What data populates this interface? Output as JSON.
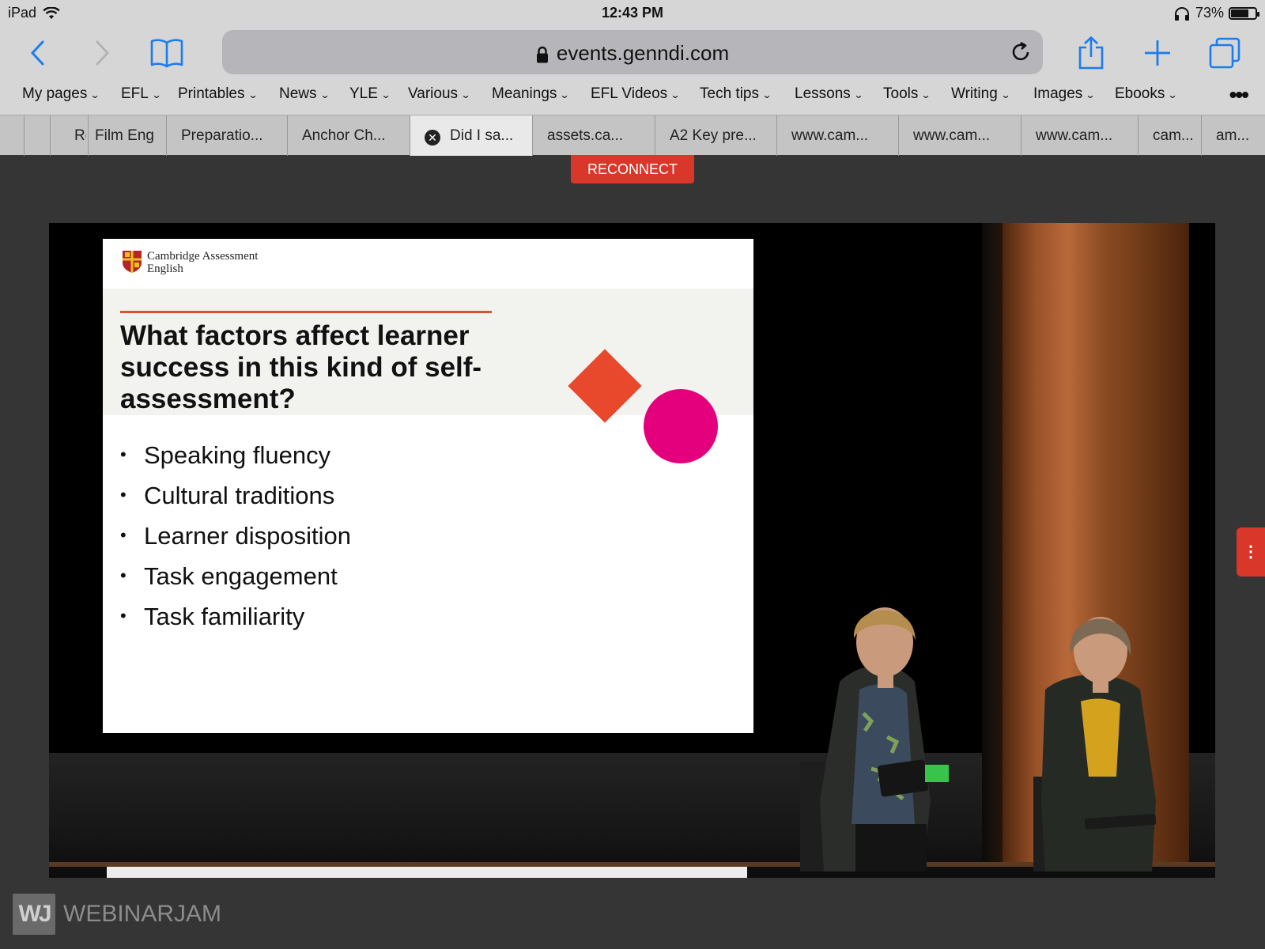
{
  "status_bar": {
    "device": "iPad",
    "time": "12:43 PM",
    "battery": "73%",
    "battery_level": 0.73
  },
  "browser": {
    "url": "events.genndi.com",
    "bookmarks": [
      "My pages",
      "EFL",
      "Printables",
      "News",
      "YLE",
      "Various",
      "Meanings",
      "EFL Videos",
      "Tech tips",
      "Lessons",
      "Tools",
      "Writing",
      "Images",
      "Ebooks"
    ],
    "tabs": [
      "Re",
      "Film Eng",
      "Preparatio...",
      "Anchor Ch...",
      "Did I sa...",
      "assets.ca...",
      "A2 Key pre...",
      "www.cam...",
      "www.cam...",
      "www.cam...",
      "cam...",
      "am..."
    ],
    "active_tab": "Did I sa..."
  },
  "page": {
    "reconnect_label": "RECONNECT",
    "footer_brand": "WEBINARJAM",
    "footer_brand_mark": "WJ"
  },
  "slide": {
    "logo_line1": "Cambridge Assessment",
    "logo_line2": "English",
    "title": "What factors affect learner success in this kind of self-assessment?",
    "bullets": [
      "Speaking fluency",
      "Cultural traditions",
      "Learner disposition",
      "Task engagement",
      "Task familiarity"
    ],
    "colors": {
      "rule": "#d9532f",
      "diamond": "#e8482b",
      "circle": "#e4007c"
    }
  },
  "colors": {
    "accent_red": "#d9372a",
    "ios_blue": "#1a7cf0"
  }
}
